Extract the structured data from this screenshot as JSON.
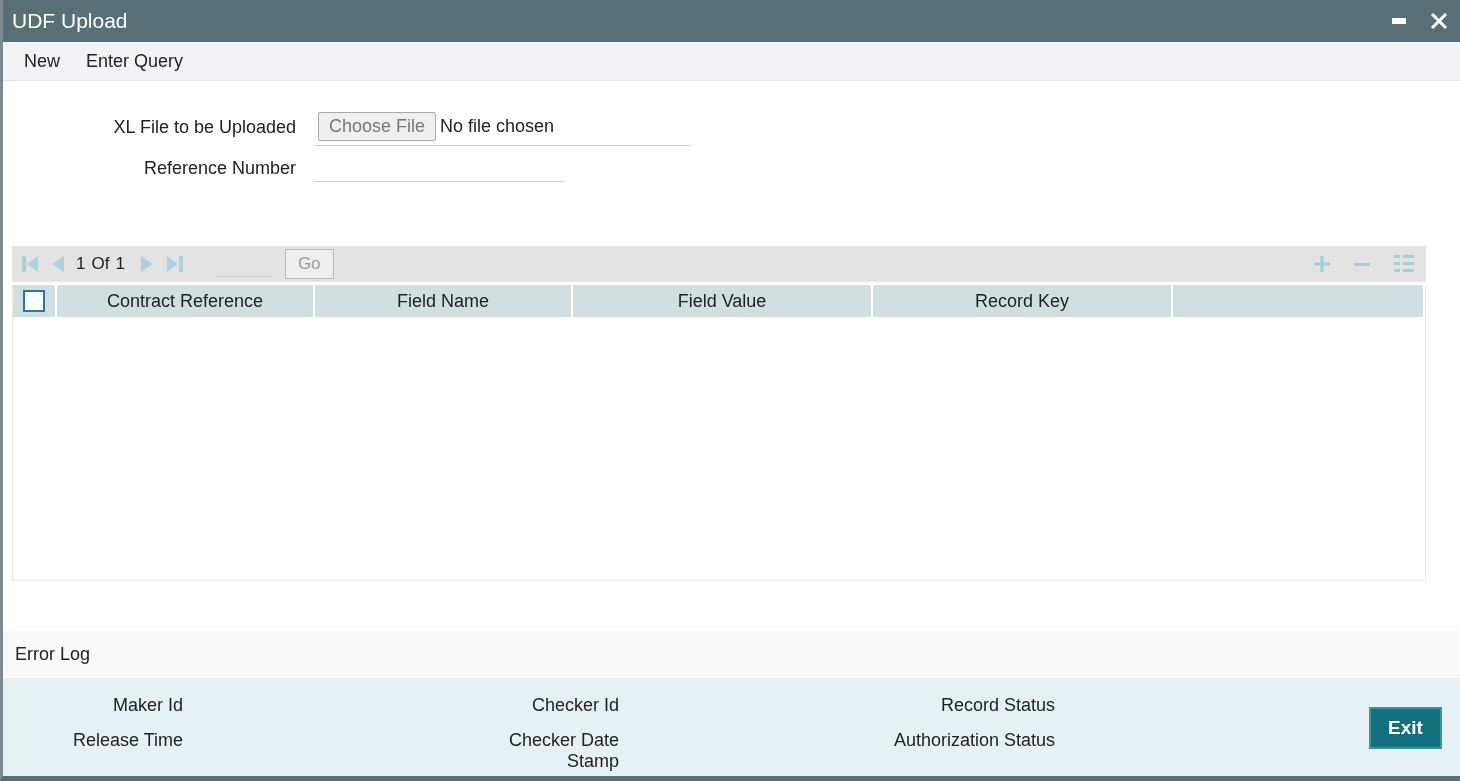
{
  "window": {
    "title": "UDF Upload"
  },
  "toolbar": [
    {
      "label": "New"
    },
    {
      "label": "Enter Query"
    }
  ],
  "form": {
    "file_label": "XL File to be Uploaded",
    "choose_button": "Choose File",
    "file_status": "No file chosen",
    "reference_label": "Reference Number"
  },
  "pager": {
    "current": "1",
    "of": "Of",
    "total": "1",
    "go": "Go"
  },
  "table": {
    "select_all": {
      "checked": false
    },
    "columns": [
      "Contract Reference",
      "Field Name",
      "Field Value",
      "Record Key",
      ""
    ]
  },
  "error_log": "Error Log",
  "footer": {
    "fields": [
      [
        "Maker Id",
        "Release Time"
      ],
      [
        "Checker Id",
        "Checker Date Stamp"
      ],
      [
        "Record Status",
        "Authorization Status"
      ]
    ],
    "exit": "Exit"
  }
}
